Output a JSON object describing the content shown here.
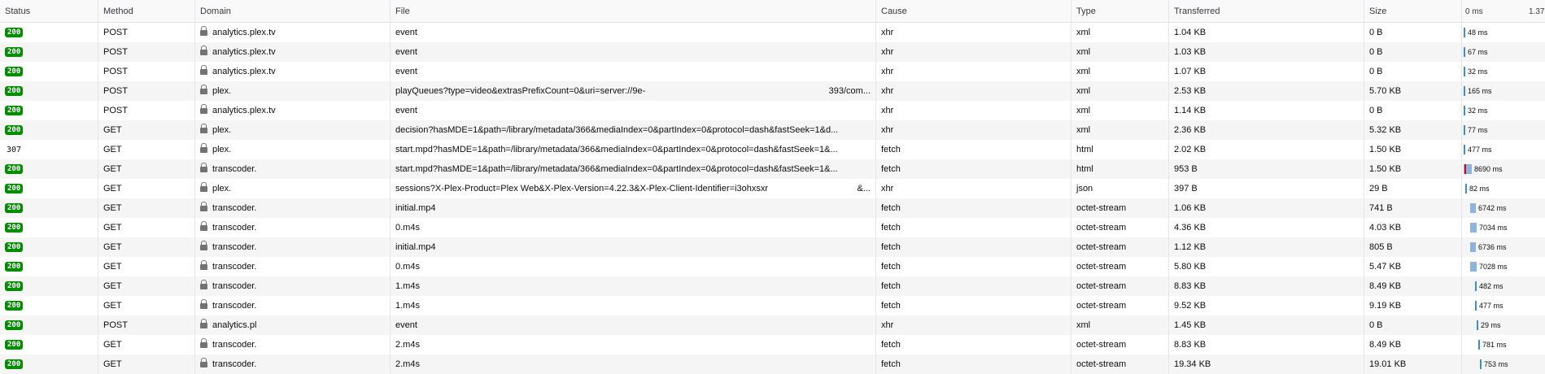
{
  "columns": {
    "status": "Status",
    "method": "Method",
    "domain": "Domain",
    "file": "File",
    "cause": "Cause",
    "type": "Type",
    "transferred": "Transferred",
    "size": "Size",
    "waterfall_start": "0 ms",
    "waterfall_end": "1.37"
  },
  "colors": {
    "status_ok": "#058b00",
    "timing_bar": "#3a8fd9",
    "timing_wait": "#8cb4df"
  },
  "icons": {
    "secure": "lock-icon"
  },
  "requests": [
    {
      "status": "200",
      "method": "POST",
      "domain": "analytics.plex.tv",
      "file": "event",
      "cause": "xhr",
      "type": "xml",
      "transferred": "1.04 KB",
      "size": "0 B",
      "time": "48 ms"
    },
    {
      "status": "200",
      "method": "POST",
      "domain": "analytics.plex.tv",
      "file": "event",
      "cause": "xhr",
      "type": "xml",
      "transferred": "1.03 KB",
      "size": "0 B",
      "time": "67 ms"
    },
    {
      "status": "200",
      "method": "POST",
      "domain": "analytics.plex.tv",
      "file": "event",
      "cause": "xhr",
      "type": "xml",
      "transferred": "1.07 KB",
      "size": "0 B",
      "time": "32 ms"
    },
    {
      "status": "200",
      "method": "POST",
      "domain": "plex.",
      "file": "playQueues?type=video&extrasPrefixCount=0&uri=server://9e-",
      "file_tail": "393/com...",
      "cause": "xhr",
      "type": "xml",
      "transferred": "2.53 KB",
      "size": "5.70 KB",
      "time": "165 ms"
    },
    {
      "status": "200",
      "method": "POST",
      "domain": "analytics.plex.tv",
      "file": "event",
      "cause": "xhr",
      "type": "xml",
      "transferred": "1.14 KB",
      "size": "0 B",
      "time": "32 ms"
    },
    {
      "status": "200",
      "method": "GET",
      "domain": "plex.",
      "file": "decision?hasMDE=1&path=/library/metadata/366&mediaIndex=0&partIndex=0&protocol=dash&fastSeek=1&d...",
      "cause": "xhr",
      "type": "xml",
      "transferred": "2.36 KB",
      "size": "5.32 KB",
      "time": "77 ms"
    },
    {
      "status": "307",
      "method": "GET",
      "domain": "plex.",
      "file": "start.mpd?hasMDE=1&path=/library/metadata/366&mediaIndex=0&partIndex=0&protocol=dash&fastSeek=1&...",
      "cause": "fetch",
      "type": "html",
      "transferred": "2.02 KB",
      "size": "1.50 KB",
      "time": "477 ms"
    },
    {
      "status": "200",
      "method": "GET",
      "domain": "transcoder.",
      "file": "start.mpd?hasMDE=1&path=/library/metadata/366&mediaIndex=0&partIndex=0&protocol=dash&fastSeek=1&...",
      "cause": "fetch",
      "type": "html",
      "transferred": "953 B",
      "size": "1.50 KB",
      "time": "8690 ms"
    },
    {
      "status": "200",
      "method": "GET",
      "domain": "plex.",
      "file": "sessions?X-Plex-Product=Plex Web&X-Plex-Version=4.22.3&X-Plex-Client-Identifier=i3ohxsxr",
      "file_tail": "&...",
      "cause": "xhr",
      "type": "json",
      "transferred": "397 B",
      "size": "29 B",
      "time": "82 ms"
    },
    {
      "status": "200",
      "method": "GET",
      "domain": "transcoder.",
      "file": "initial.mp4",
      "cause": "fetch",
      "type": "octet-stream",
      "transferred": "1.06 KB",
      "size": "741 B",
      "time": "6742 ms"
    },
    {
      "status": "200",
      "method": "GET",
      "domain": "transcoder.",
      "file": "0.m4s",
      "cause": "fetch",
      "type": "octet-stream",
      "transferred": "4.36 KB",
      "size": "4.03 KB",
      "time": "7034 ms"
    },
    {
      "status": "200",
      "method": "GET",
      "domain": "transcoder.",
      "file": "initial.mp4",
      "cause": "fetch",
      "type": "octet-stream",
      "transferred": "1.12 KB",
      "size": "805 B",
      "time": "6736 ms"
    },
    {
      "status": "200",
      "method": "GET",
      "domain": "transcoder.",
      "file": "0.m4s",
      "cause": "fetch",
      "type": "octet-stream",
      "transferred": "5.80 KB",
      "size": "5.47 KB",
      "time": "7028 ms"
    },
    {
      "status": "200",
      "method": "GET",
      "domain": "transcoder.",
      "file": "1.m4s",
      "cause": "fetch",
      "type": "octet-stream",
      "transferred": "8.83 KB",
      "size": "8.49 KB",
      "time": "482 ms"
    },
    {
      "status": "200",
      "method": "GET",
      "domain": "transcoder.",
      "file": "1.m4s",
      "cause": "fetch",
      "type": "octet-stream",
      "transferred": "9.52 KB",
      "size": "9.19 KB",
      "time": "477 ms"
    },
    {
      "status": "200",
      "method": "POST",
      "domain": "analytics.pl",
      "file": "event",
      "cause": "xhr",
      "type": "xml",
      "transferred": "1.45 KB",
      "size": "0 B",
      "time": "29 ms"
    },
    {
      "status": "200",
      "method": "GET",
      "domain": "transcoder.",
      "file": "2.m4s",
      "cause": "fetch",
      "type": "octet-stream",
      "transferred": "8.83 KB",
      "size": "8.49 KB",
      "time": "781 ms"
    },
    {
      "status": "200",
      "method": "GET",
      "domain": "transcoder.",
      "file": "2.m4s",
      "cause": "fetch",
      "type": "octet-stream",
      "transferred": "19.34 KB",
      "size": "19.01 KB",
      "time": "753 ms"
    }
  ]
}
